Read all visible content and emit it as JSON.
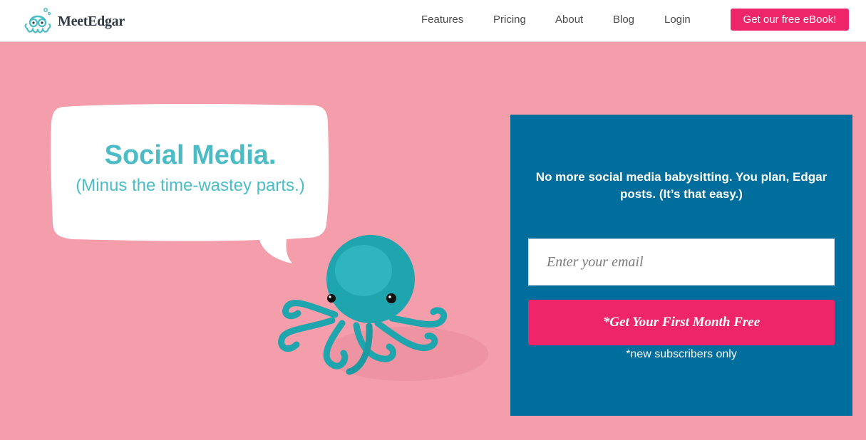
{
  "header": {
    "logo_text": "MeetEdgar",
    "nav_items": [
      {
        "label": "Features"
      },
      {
        "label": "Pricing"
      },
      {
        "label": "About"
      },
      {
        "label": "Blog"
      },
      {
        "label": "Login"
      }
    ],
    "ebook_button_label": "Get our free eBook!"
  },
  "hero": {
    "title": "Social Media.",
    "subtitle": "(Minus the time-wastey parts.)",
    "mascot_icon": "crochet-octopus-image"
  },
  "signup": {
    "headline": "No more social media babysitting. You plan, Edgar posts. (It’s that easy.)",
    "email_placeholder": "Enter your email",
    "cta_label": "*Get Your First Month Free",
    "fine_print": "*new subscribers only"
  },
  "colors": {
    "hero_background": "#f49dab",
    "accent_pink": "#ee2569",
    "panel_blue": "#006e9d",
    "bubble_text": "#4bbcc6"
  }
}
